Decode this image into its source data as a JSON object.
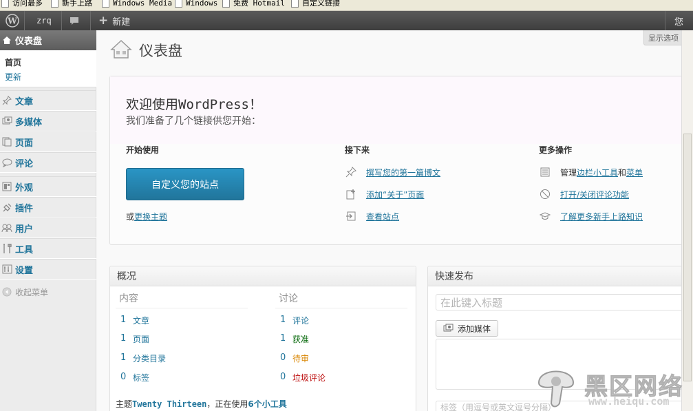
{
  "bookmarks": [
    "访问最多",
    "新手上路",
    "Windows Media",
    "Windows",
    "免费 Hotmail",
    "自定义链接"
  ],
  "adminbar": {
    "user": "zrq",
    "new_label": "新建",
    "right_partial": "您"
  },
  "sidebar": {
    "dashboard": "仪表盘",
    "submenu": {
      "home": "首页",
      "updates": "更新"
    },
    "items": [
      {
        "label": "文章",
        "icon": "pin-icon"
      },
      {
        "label": "多媒体",
        "icon": "media-icon"
      },
      {
        "label": "页面",
        "icon": "page-icon"
      },
      {
        "label": "评论",
        "icon": "comment-icon"
      },
      {
        "label": "外观",
        "icon": "appearance-icon"
      },
      {
        "label": "插件",
        "icon": "plugin-icon"
      },
      {
        "label": "用户",
        "icon": "users-icon"
      },
      {
        "label": "工具",
        "icon": "tools-icon"
      },
      {
        "label": "设置",
        "icon": "settings-icon"
      }
    ],
    "collapse": "收起菜单"
  },
  "main": {
    "screen_options": "显示选项",
    "title": "仪表盘",
    "welcome": {
      "heading": "欢迎使用WordPress！",
      "about": "我们准备了几个链接供您开始：",
      "col1_title": "开始使用",
      "customize_button": "自定义您的站点",
      "or_text": "或",
      "change_theme": "更换主题",
      "col2_title": "接下来",
      "next_steps": [
        "撰写您的第一篇博文",
        "添加“关于”页面",
        "查看站点"
      ],
      "col3_title": "更多操作",
      "manage_prefix": "管理",
      "widgets_link": "边栏小工具",
      "and_text": "和",
      "menus_link": "菜单",
      "toggle_comments": "打开/关闭评论功能",
      "learn_more": "了解更多新手上路知识"
    },
    "right_now": {
      "title": "概况",
      "content_head": "内容",
      "discussion_head": "讨论",
      "content": [
        {
          "n": "1",
          "label": "文章"
        },
        {
          "n": "1",
          "label": "页面"
        },
        {
          "n": "1",
          "label": "分类目录"
        },
        {
          "n": "0",
          "label": "标签"
        }
      ],
      "discussion": [
        {
          "n": "1",
          "label": "评论",
          "color": "#21759b"
        },
        {
          "n": "1",
          "label": "获准",
          "color": "#006505"
        },
        {
          "n": "0",
          "label": "待审",
          "color": "#d98500"
        },
        {
          "n": "0",
          "label": "垃圾评论",
          "color": "#bc0b0b"
        }
      ],
      "theme_prefix": "主题",
      "theme_name": "Twenty Thirteen",
      "theme_mid": "，正在使用",
      "widgets_count": "6个小工具"
    },
    "quick_press": {
      "title": "快速发布",
      "title_placeholder": "在此键入标题",
      "add_media": "添加媒体",
      "tags_placeholder": "标签（用逗号或英文逗号分隔）"
    }
  },
  "watermark": {
    "cn": "黑区网络",
    "url": "www.heiqu.com"
  },
  "colors": {
    "link": "#21759b",
    "adminbar": "#464646",
    "button": "#21759b"
  }
}
